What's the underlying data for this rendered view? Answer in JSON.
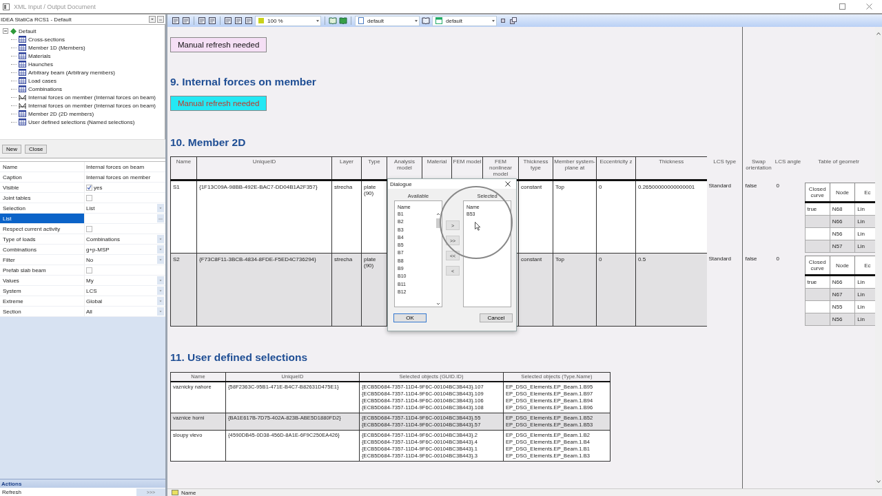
{
  "window": {
    "title": "XML Input / Output Document"
  },
  "left_panel": {
    "project": "IDEA StatiCa RCS1 - Default",
    "tree": {
      "label": "Default",
      "expanded": true,
      "children": [
        {
          "label": "Cross-sections",
          "kind": "table"
        },
        {
          "label": "Member 1D (Members)",
          "kind": "table"
        },
        {
          "label": "Materials",
          "kind": "table"
        },
        {
          "label": "Haunches",
          "kind": "table"
        },
        {
          "label": "Arbitrary beam (Arbitrary members)",
          "kind": "table"
        },
        {
          "label": "Load cases",
          "kind": "table"
        },
        {
          "label": "Combinations",
          "kind": "table"
        },
        {
          "label": "Internal forces on member (Internal forces on beam)",
          "kind": "forces"
        },
        {
          "label": "Internal forces on member (Internal forces on beam)",
          "kind": "forces"
        },
        {
          "label": "Member 2D (2D members)",
          "kind": "table"
        },
        {
          "label": "User defined selections (Named selections)",
          "kind": "table"
        }
      ]
    },
    "buttons": [
      "New",
      "Close"
    ],
    "properties": [
      {
        "name": "Name",
        "kind": "text",
        "value": "Internal forces on beam",
        "selected": false
      },
      {
        "name": "Caption",
        "kind": "text",
        "value": "Internal forces on member",
        "selected": false
      },
      {
        "name": "Visible",
        "kind": "check",
        "checked": true,
        "value": "yes",
        "selected": false
      },
      {
        "name": "Joint tables",
        "kind": "check",
        "checked": false,
        "selected": false
      },
      {
        "name": "Selection",
        "kind": "combo",
        "value": "List",
        "selected": false
      },
      {
        "name": "List",
        "kind": "ellipsis",
        "selected": true
      },
      {
        "name": "Respect current activity",
        "kind": "check",
        "checked": false,
        "selected": false
      },
      {
        "name": "Type of loads",
        "kind": "combo",
        "value": "Combinations",
        "selected": false
      },
      {
        "name": "Combinations",
        "kind": "combo",
        "value": "g+p-MSP",
        "selected": false
      },
      {
        "name": "Filter",
        "kind": "combo",
        "value": "No",
        "selected": false
      },
      {
        "name": "Prefab slab beam",
        "kind": "check",
        "checked": false,
        "selected": false
      },
      {
        "name": "Values",
        "kind": "combo",
        "value": "My",
        "selected": false
      },
      {
        "name": "System",
        "kind": "combo",
        "value": "LCS",
        "selected": false
      },
      {
        "name": "Extreme",
        "kind": "combo",
        "value": "Global",
        "selected": false
      },
      {
        "name": "Section",
        "kind": "combo",
        "value": "All",
        "selected": false
      }
    ],
    "actions": {
      "title": "Actions",
      "items": [
        {
          "label": "Refresh",
          "button": ">>>"
        }
      ]
    }
  },
  "toolbar": {
    "zoom": "100 %",
    "style": "default",
    "template": "default"
  },
  "document": {
    "notice_1": {
      "text": "Manual refresh needed",
      "active": false
    },
    "section_9": {
      "title": "9. Internal forces on member",
      "notice": {
        "text": "Manual refresh needed",
        "active": true
      }
    },
    "section_10": {
      "title": "10. Member 2D",
      "columns": [
        "Name",
        "UniqueID",
        "Layer",
        "Type",
        "Analysis model",
        "Material",
        "FEM model",
        "FEM nonlinear model",
        "Thickness type",
        "Member system-plane at",
        "Eccentricity z",
        "Thickness",
        "LCS type",
        "Swap orientation",
        "LCS angle",
        "Table of geometr"
      ],
      "rows": [
        {
          "name": "S1",
          "unique_id": "{1F13C09A-98BB-492E-BAC7-DD04B1A2F357}",
          "layer": "strecha",
          "type": "plate (90)",
          "thickness_type": "constant",
          "member_system_plane_at": "Top",
          "eccentricity_z": "0",
          "thickness": "0.26500000000000001",
          "lcs_type": "Standard",
          "swap_orientation": "false",
          "lcs_angle": "0",
          "geometry": {
            "columns": [
              "Closed curve",
              "Node",
              "Ec"
            ],
            "rows": [
              {
                "closed_curve": "true",
                "node": "N68",
                "column_3": "Lin"
              },
              {
                "node": "N66",
                "column_3": "Lin"
              },
              {
                "node": "N56",
                "column_3": "Lin"
              },
              {
                "node": "N57",
                "column_3": "Lin"
              }
            ]
          }
        },
        {
          "name": "S2",
          "unique_id": "{F73C8F11-3BCB-4834-8FDE-F5ED4C736294}",
          "layer": "strecha",
          "type": "plate (90)",
          "thickness_type": "constant",
          "member_system_plane_at": "Top",
          "eccentricity_z": "0",
          "thickness": "0.5",
          "lcs_type": "Standard",
          "swap_orientation": "false",
          "lcs_angle": "0",
          "geometry": {
            "columns": [
              "Closed curve",
              "Node",
              "Ec"
            ],
            "rows": [
              {
                "closed_curve": "true",
                "node": "N66",
                "column_3": "Lin"
              },
              {
                "node": "N67",
                "column_3": "Lin"
              },
              {
                "node": "N55",
                "column_3": "Lin"
              },
              {
                "node": "N56",
                "column_3": "Lin"
              }
            ]
          }
        }
      ]
    },
    "section_11": {
      "title": "11. User defined selections",
      "columns": [
        "Name",
        "UniqueID",
        "Selected objects (GUID.ID)",
        "Selected objects (Type.Name)"
      ],
      "rows": [
        {
          "name": "vaznicky nahore",
          "unique_id": "{58F2363C-95B1-471E-B4C7-B82631D475E1}",
          "guids": [
            "{ECB5D684-7357-11D4-9F6C-00104BC3B443}.107",
            "{ECB5D684-7357-11D4-9F6C-00104BC3B443}.109",
            "{ECB5D684-7357-11D4-9F6C-00104BC3B443}.106",
            "{ECB5D684-7357-11D4-9F6C-00104BC3B443}.108"
          ],
          "type_names": [
            "EP_DSG_Elements.EP_Beam.1.B95",
            "EP_DSG_Elements.EP_Beam.1.B97",
            "EP_DSG_Elements.EP_Beam.1.B94",
            "EP_DSG_Elements.EP_Beam.1.B96"
          ]
        },
        {
          "name": "vaznice horni",
          "unique_id": "{BA1E617B-7D75-402A-823B-ABE5D1880FD2}",
          "guids": [
            "{ECB5D684-7357-11D4-9F6C-00104BC3B443}.55",
            "{ECB5D684-7357-11D4-9F6C-00104BC3B443}.57"
          ],
          "type_names": [
            "EP_DSG_Elements.EP_Beam.1.B52",
            "EP_DSG_Elements.EP_Beam.1.B53"
          ]
        },
        {
          "name": "sloupy vlevo",
          "unique_id": "{4590DB45-0D38-456D-8A1E-6F9C250EA426}",
          "guids": [
            "{ECB5D684-7357-11D4-9F6C-00104BC3B443}.2",
            "{ECB5D684-7357-11D4-9F6C-00104BC3B443}.4",
            "{ECB5D684-7357-11D4-9F6C-00104BC3B443}.1",
            "{ECB5D684-7357-11D4-9F6C-00104BC3B443}.3"
          ],
          "type_names": [
            "EP_DSG_Elements.EP_Beam.1.B2",
            "EP_DSG_Elements.EP_Beam.1.B4",
            "EP_DSG_Elements.EP_Beam.1.B1",
            "EP_DSG_Elements.EP_Beam.1.B3"
          ]
        }
      ]
    }
  },
  "dialog": {
    "title": "Dialogue",
    "available": {
      "label": "Available",
      "column": "Name",
      "items": [
        "B1",
        "B2",
        "B3",
        "B4",
        "B5",
        "B7",
        "B8",
        "B9",
        "B10",
        "B11",
        "B12"
      ]
    },
    "move_buttons": [
      ">",
      ">>",
      "<<",
      "<"
    ],
    "selected": {
      "label": "Selected",
      "column": "Name",
      "items": [
        "B53"
      ]
    },
    "buttons": [
      {
        "label": "OK",
        "kind": "default"
      },
      {
        "label": "Cancel",
        "kind": "normal"
      }
    ]
  },
  "status_bar": {
    "label": "Name"
  }
}
